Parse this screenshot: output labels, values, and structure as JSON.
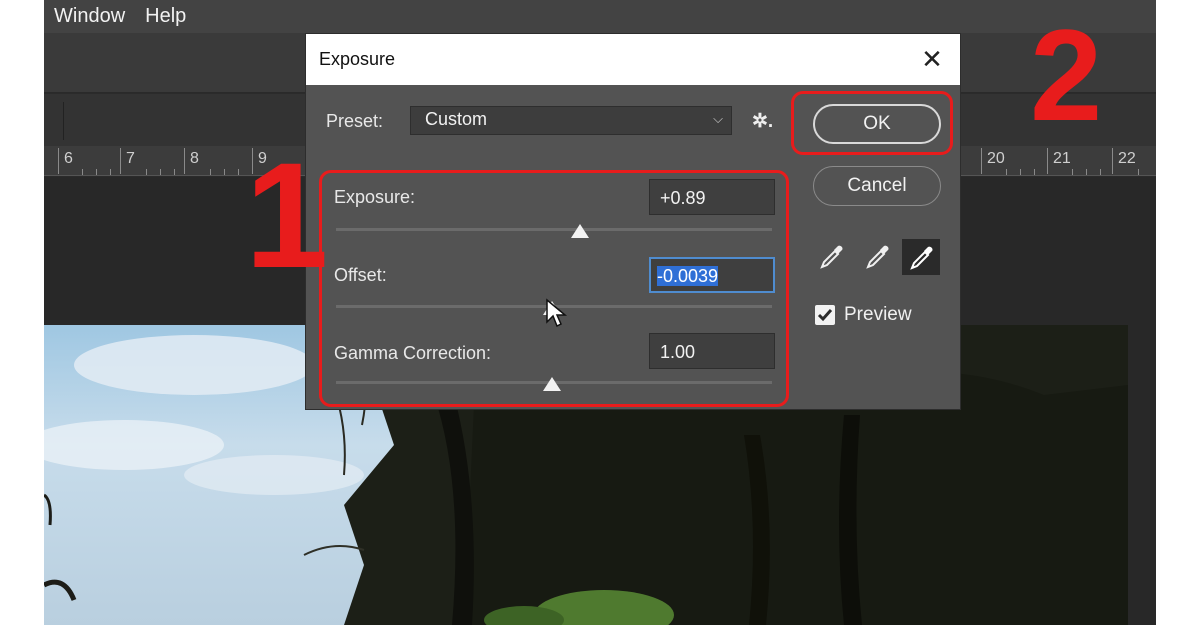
{
  "menubar": {
    "items": [
      "Window",
      "Help"
    ]
  },
  "ruler": {
    "ticks": [
      "6",
      "7",
      "8",
      "9",
      "20",
      "21",
      "22"
    ]
  },
  "dialog": {
    "title": "Exposure",
    "close_glyph": "✕",
    "preset_label": "Preset:",
    "preset_value": "Custom",
    "preset_chevron": "⌵",
    "gear_glyph": "✲.",
    "exposure_label": "Exposure:",
    "exposure_value": "+0.89",
    "exposure_slider": 0.56,
    "offset_label": "Offset:",
    "offset_value": "-0.0039",
    "offset_slider": 0.495,
    "gamma_label": "Gamma Correction:",
    "gamma_value": "1.00",
    "gamma_slider": 0.495,
    "ok_label": "OK",
    "cancel_label": "Cancel",
    "preview_label": "Preview",
    "preview_checked": true
  },
  "annotations": {
    "step1": "1",
    "step2": "2",
    "color": "#e81c1c"
  },
  "icons": [
    "close-icon",
    "chevron-down-icon",
    "gear-icon",
    "eyedropper-black-icon",
    "eyedropper-gray-icon",
    "eyedropper-white-icon",
    "checkbox-checked-icon",
    "mouse-cursor-icon"
  ]
}
